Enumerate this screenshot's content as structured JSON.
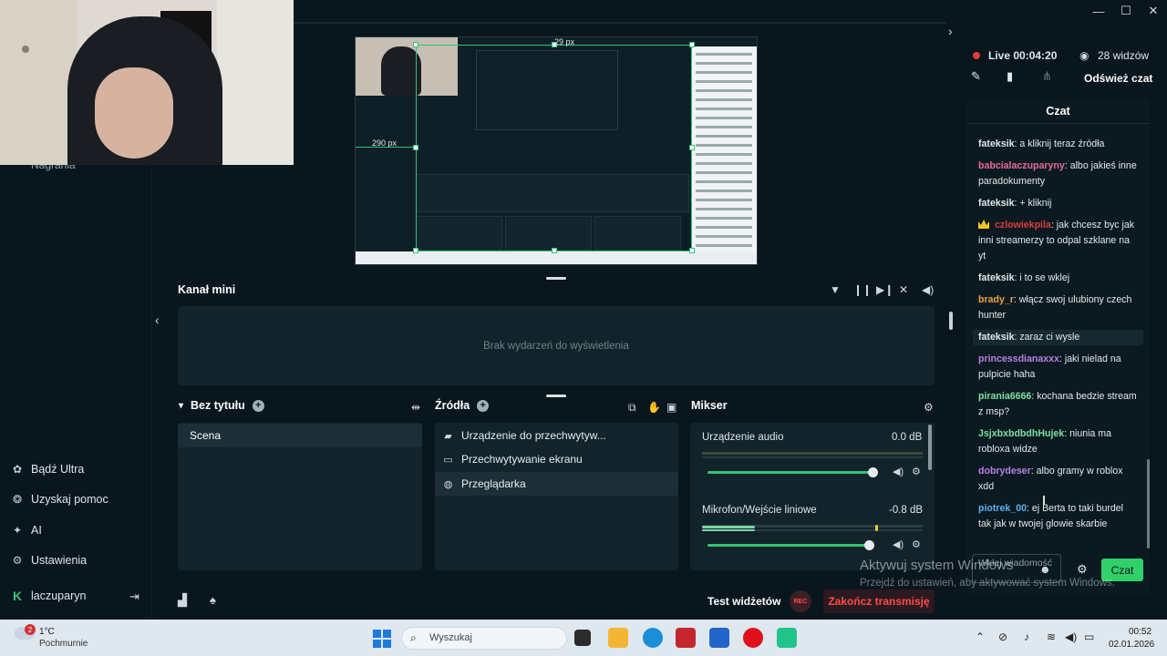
{
  "window": {
    "minimize": "—",
    "maximize": "☐",
    "close": "✕"
  },
  "sidebar": {
    "behind_text": "Nagrania",
    "items": [
      {
        "label": "Bądź Ultra",
        "icon": "ultra-icon"
      },
      {
        "label": "Uzyskaj pomoc",
        "icon": "help-icon"
      },
      {
        "label": "AI",
        "icon": "ai-sparkle-icon"
      },
      {
        "label": "Ustawienia",
        "icon": "gear-icon"
      }
    ],
    "user": "laczuparyn"
  },
  "preview": {
    "width_label": "29  px",
    "left_label": "290  px"
  },
  "stream": {
    "live_label": "Live 00:04:20",
    "viewers": "28 widzów",
    "refresh_chat": "Odśwież czat"
  },
  "chat": {
    "title": "Czat",
    "messages": [
      {
        "user": "fateksik",
        "color": "#e3e8eb",
        "text": "a kliknij teraz źródła"
      },
      {
        "user": "babcialaczuparyny",
        "color": "#e86a9a",
        "text": "albo jakieś inne paradokumenty"
      },
      {
        "user": "fateksik",
        "color": "#e3e8eb",
        "text": "+ kliknij"
      },
      {
        "user": "czlowiekpila",
        "color": "#e03b3b",
        "text": "jak chcesz byc jak inni streamerzy to odpal szklane na yt",
        "badge": "crown-icon"
      },
      {
        "user": "fateksik",
        "color": "#e3e8eb",
        "text": "i to se wklej"
      },
      {
        "user": "brady_r",
        "color": "#f0a040",
        "text": "włącz swoj ulubiony czech hunter"
      },
      {
        "user": "fateksik",
        "color": "#e3e8eb",
        "text": "zaraz ci wysle",
        "highlight": true
      },
      {
        "user": "princessdianaxxx",
        "color": "#b880e0",
        "text": "jaki nielad na pulpicie haha"
      },
      {
        "user": "pirania6666",
        "color": "#7ee0a0",
        "text": "kochana bedzie stream z msp?"
      },
      {
        "user": "JsjxbxbdbdhHujek",
        "color": "#7ee0a0",
        "text": "niunia ma robloxa widze"
      },
      {
        "user": "dobrydeser",
        "color": "#b880e0",
        "text": "albo gramy w roblox xdd"
      },
      {
        "user": "piotrek_00",
        "color": "#5ab0f0",
        "text": "ej Berta to taki burdel tak jak w twojej glowie skarbie"
      }
    ],
    "input_placeholder": "Wklej wiadomość",
    "send_label": "Czat"
  },
  "mini_feed": {
    "title": "Kanał mini",
    "empty_text": "Brak wydarzeń do wyświetlenia"
  },
  "scenes": {
    "title": "Bez tytułu",
    "items": [
      "Scena"
    ]
  },
  "sources": {
    "title": "Źródła",
    "items": [
      {
        "label": "Urządzenie do przechwytyw...",
        "icon": "camera-icon"
      },
      {
        "label": "Przechwytywanie ekranu",
        "icon": "monitor-icon"
      },
      {
        "label": "Przeglądarka",
        "icon": "globe-icon",
        "selected": true
      }
    ]
  },
  "mixer": {
    "title": "Mikser",
    "channels": [
      {
        "name": "Urządzenie audio",
        "db": "0.0 dB",
        "volume": 1.0
      },
      {
        "name": "Mikrofon/Wejście liniowe",
        "db": "-0.8 dB",
        "volume": 0.98
      }
    ]
  },
  "bottom": {
    "test_widgets": "Test widżetów",
    "rec": "REC",
    "end_stream": "Zakończ transmisję"
  },
  "watermark": {
    "line1": "Aktywuj system Windows",
    "line2": "Przejdź do ustawień, aby aktywować system Windows."
  },
  "taskbar": {
    "weather_badge": "2",
    "temp": "1°C",
    "condition": "Pochmurnie",
    "search_placeholder": "Wyszukaj",
    "time": "00:52",
    "date": "02.01.2026"
  }
}
